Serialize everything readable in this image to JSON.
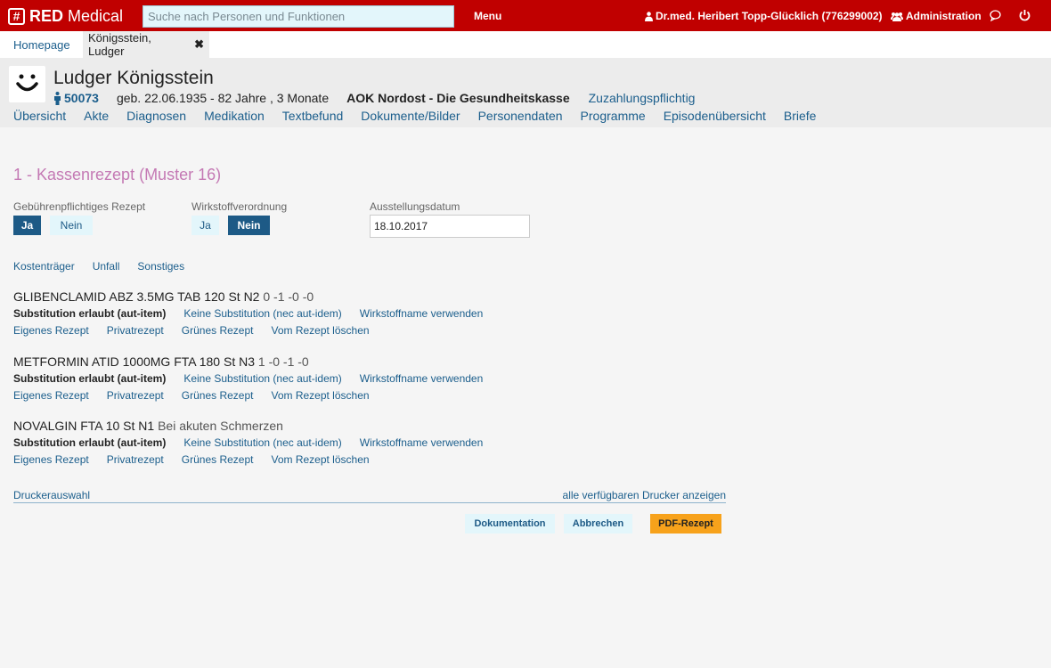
{
  "topbar": {
    "brand_logo": "#",
    "brand_bold": "RED",
    "brand_rest": " Medical",
    "search_placeholder": "Suche nach Personen und Funktionen",
    "menu_label": "Menu",
    "user_label": "Dr.med. Heribert Topp-Glücklich (776299002)",
    "admin_label": "Administration",
    "bg_color": "#c00000"
  },
  "tabs": {
    "home": "Homepage",
    "active": "Königsstein, Ludger",
    "close_glyph": "✖"
  },
  "patient": {
    "name": "Ludger Königsstein",
    "id": "50073",
    "birth": "geb. 22.06.1935 - 82 Jahre , 3 Monate",
    "insurance": "AOK Nordost - Die Gesundheitskasse",
    "copay": "Zuzahlungspflichtig",
    "nav": [
      "Übersicht",
      "Akte",
      "Diagnosen",
      "Medikation",
      "Textbefund",
      "Dokumente/Bilder",
      "Personendaten",
      "Programme",
      "Episodenübersicht",
      "Briefe"
    ]
  },
  "form": {
    "title": "1 - Kassenrezept (Muster 16)",
    "fee_label": "Gebührenpflichtiges Rezept",
    "fee_yes": "Ja",
    "fee_no": "Nein",
    "fee_selected": "Ja",
    "substance_label": "Wirkstoffverordnung",
    "substance_yes": "Ja",
    "substance_no": "Nein",
    "substance_selected": "Nein",
    "date_label": "Ausstellungsdatum",
    "date_value": "18.10.2017",
    "options": [
      "Kostenträger",
      "Unfall",
      "Sonstiges"
    ]
  },
  "medications": [
    {
      "name": "GLIBENCLAMID ABZ 3.5MG TAB 120 St N2",
      "dosage": "0 -1 -0 -0",
      "subst_selected": "Substitution erlaubt (aut-item)",
      "subst_alt": "Keine Substitution (nec aut-idem)",
      "subst_name": "Wirkstoffname verwenden",
      "actions": [
        "Eigenes Rezept",
        "Privatrezept",
        "Grünes Rezept",
        "Vom Rezept löschen"
      ]
    },
    {
      "name": "METFORMIN ATID 1000MG FTA 180 St N3",
      "dosage": "1 -0 -1 -0",
      "subst_selected": "Substitution erlaubt (aut-item)",
      "subst_alt": "Keine Substitution (nec aut-idem)",
      "subst_name": "Wirkstoffname verwenden",
      "actions": [
        "Eigenes Rezept",
        "Privatrezept",
        "Grünes Rezept",
        "Vom Rezept löschen"
      ]
    },
    {
      "name": "NOVALGIN FTA 10 St N1",
      "dosage": "Bei akuten Schmerzen",
      "subst_selected": "Substitution erlaubt (aut-item)",
      "subst_alt": "Keine Substitution (nec aut-idem)",
      "subst_name": "Wirkstoffname verwenden",
      "actions": [
        "Eigenes Rezept",
        "Privatrezept",
        "Grünes Rezept",
        "Vom Rezept löschen"
      ]
    }
  ],
  "printer": {
    "label": "Druckerauswahl",
    "show_all": "alle verfügbaren Drucker anzeigen"
  },
  "actions": {
    "documentation": "Dokumentation",
    "cancel": "Abbrechen",
    "pdf": "PDF-Rezept"
  },
  "colors": {
    "accent": "#1d5a86",
    "title": "#c479b4",
    "pdf_button": "#f7a21b"
  }
}
